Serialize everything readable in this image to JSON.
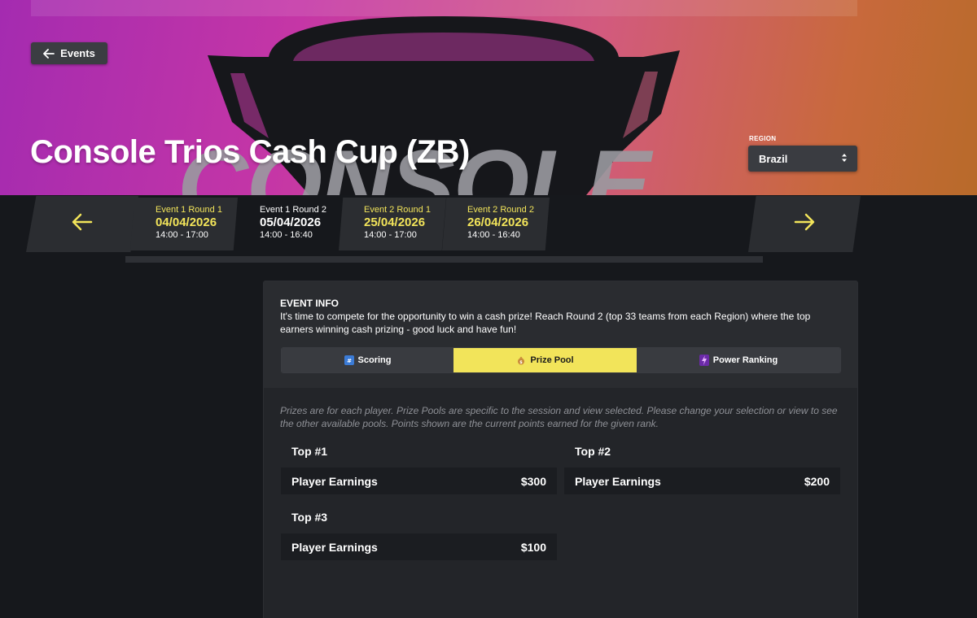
{
  "hero": {
    "back_label": "Events",
    "title": "Console Trios Cash Cup (ZB)",
    "region_label": "REGION",
    "region_value": "Brazil"
  },
  "sessions": [
    {
      "name": "Event 1 Round 1",
      "date": "04/04/2026",
      "time": "14:00 - 17:00",
      "active": false
    },
    {
      "name": "Event 1 Round 2",
      "date": "05/04/2026",
      "time": "14:00 - 16:40",
      "active": true
    },
    {
      "name": "Event 2 Round 1",
      "date": "25/04/2026",
      "time": "14:00 - 17:00",
      "active": false
    },
    {
      "name": "Event 2 Round 2",
      "date": "26/04/2026",
      "time": "14:00 - 16:40",
      "active": false
    }
  ],
  "event_info": {
    "title": "EVENT INFO",
    "description": "It's time to compete for the opportunity to win a cash prize! Reach Round 2 (top 33 teams from each Region) where the top earners winning cash prizing - good luck and have fun!"
  },
  "tabs": [
    {
      "label": "Scoring",
      "icon": "scoring-icon",
      "active": false
    },
    {
      "label": "Prize Pool",
      "icon": "money-bag-icon",
      "active": true
    },
    {
      "label": "Power Ranking",
      "icon": "lightning-icon",
      "active": false
    }
  ],
  "prize_pool": {
    "note": "Prizes are for each player. Prize Pools are specific to the session and view selected. Please change your selection or view to see the other available pools. Points shown are the current points earned for the given rank.",
    "prizes": [
      {
        "rank": "Top #1",
        "label": "Player Earnings",
        "amount": "$300"
      },
      {
        "rank": "Top #2",
        "label": "Player Earnings",
        "amount": "$200"
      },
      {
        "rank": "Top #3",
        "label": "Player Earnings",
        "amount": "$100"
      }
    ]
  },
  "colors": {
    "accent_yellow": "#f2e45a",
    "panel_bg": "#232529",
    "page_bg": "#16181c"
  }
}
